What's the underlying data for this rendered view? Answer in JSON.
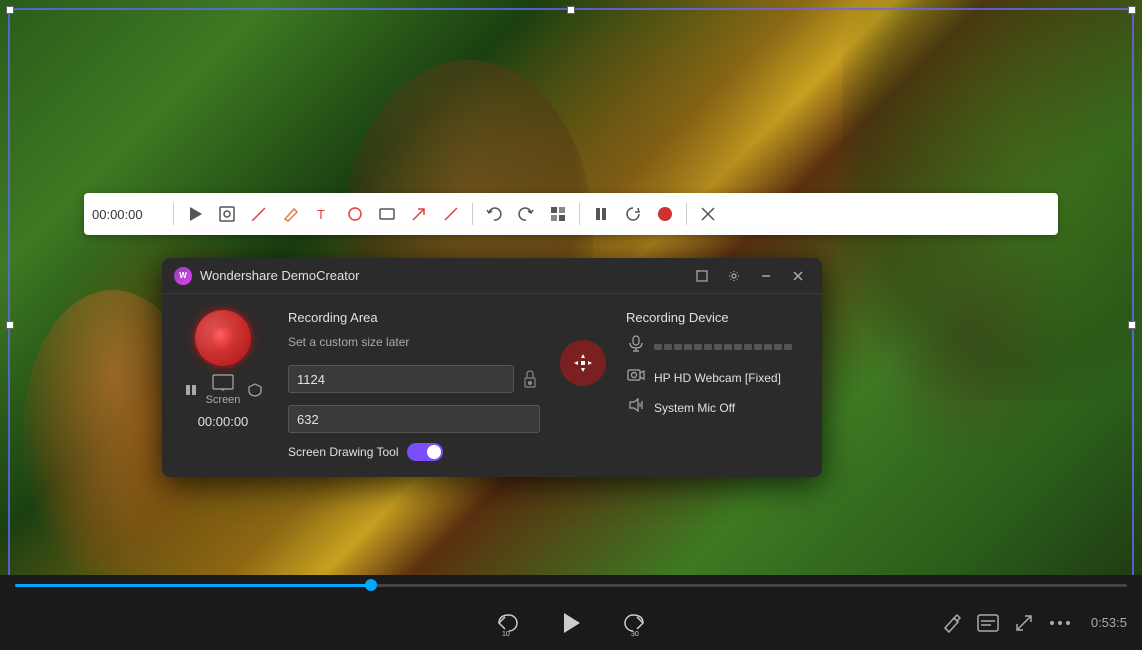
{
  "app": {
    "title": "Wondershare DemoCreator",
    "logo": "W"
  },
  "toolbar": {
    "timestamp": "00:00:00",
    "tools": [
      {
        "name": "play",
        "label": "▶"
      },
      {
        "name": "camera",
        "label": "⬜"
      },
      {
        "name": "brush",
        "label": "✏"
      },
      {
        "name": "pencil",
        "label": "✏"
      },
      {
        "name": "text",
        "label": "T"
      },
      {
        "name": "circle",
        "label": "○"
      },
      {
        "name": "rectangle",
        "label": "▭"
      },
      {
        "name": "arrow",
        "label": "↗"
      },
      {
        "name": "line",
        "label": "╱"
      },
      {
        "name": "undo",
        "label": "↩"
      },
      {
        "name": "redo",
        "label": "↪"
      },
      {
        "name": "blur",
        "label": "⬛"
      },
      {
        "name": "pause",
        "label": "⏸"
      },
      {
        "name": "replay",
        "label": "↺"
      },
      {
        "name": "record",
        "label": "●"
      }
    ]
  },
  "window": {
    "title": "Wondershare DemoCreator",
    "controls": {
      "expand": "⊞",
      "settings": "⚙",
      "minimize": "—",
      "close": "✕"
    }
  },
  "recording": {
    "area_title": "Recording Area",
    "custom_size_label": "Set a custom size later",
    "width": "1124",
    "height": "632",
    "screen_label": "Screen",
    "timer": "00:00:00",
    "drawing_tool_label": "Screen Drawing Tool",
    "drawing_enabled": true
  },
  "recording_device": {
    "title": "Recording Device",
    "webcam": "HP HD Webcam [Fixed]",
    "audio": "System Mic Off"
  },
  "playback": {
    "timestamp": "0:53:5",
    "progress_percent": 32
  },
  "mic_segments": [
    0,
    0,
    0,
    0,
    0,
    0,
    0,
    0,
    0,
    0,
    0,
    0,
    0,
    0
  ]
}
